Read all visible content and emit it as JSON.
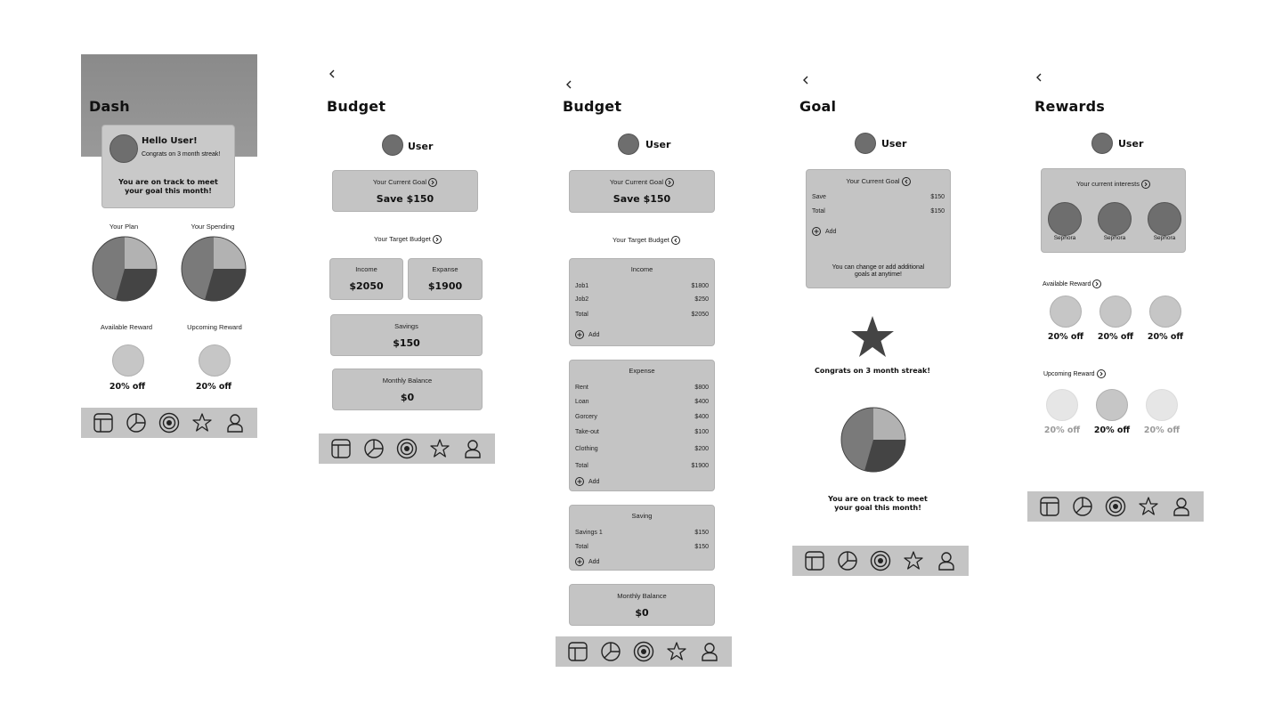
{
  "dash": {
    "title": "Dash",
    "greeting": "Hello User!",
    "streak": "Congrats on 3 month streak!",
    "message": "You are on track to meet your goal this month!",
    "plan_label": "Your Plan",
    "spending_label": "Your Spending",
    "available_label": "Available Reward",
    "upcoming_label": "Upcoming Reward",
    "available_value": "20% off",
    "upcoming_value": "20% off"
  },
  "budget1": {
    "title": "Budget",
    "user": "User",
    "goal_label": "Your Current Goal",
    "goal_value": "Save $150",
    "target_label": "Your Target Budget",
    "income_label": "Income",
    "income_value": "$2050",
    "expense_label": "Expanse",
    "expense_value": "$1900",
    "savings_label": "Savings",
    "savings_value": "$150",
    "balance_label": "Monthly Balance",
    "balance_value": "$0"
  },
  "budget2": {
    "title": "Budget",
    "user": "User",
    "goal_label": "Your Current Goal",
    "goal_value": "Save $150",
    "target_label": "Your Target Budget",
    "income": {
      "label": "Income",
      "rows": [
        [
          "Job1",
          "$1800"
        ],
        [
          "Job2",
          "$250"
        ],
        [
          "Total",
          "$2050"
        ]
      ],
      "add": "Add"
    },
    "expense": {
      "label": "Expense",
      "rows": [
        [
          "Rent",
          "$800"
        ],
        [
          "Loan",
          "$400"
        ],
        [
          "Gorcery",
          "$400"
        ],
        [
          "Take-out",
          "$100"
        ],
        [
          "Clothing",
          "$200"
        ],
        [
          "Total",
          "$1900"
        ]
      ],
      "add": "Add"
    },
    "saving": {
      "label": "Saving",
      "rows": [
        [
          "Savings 1",
          "$150"
        ],
        [
          "Total",
          "$150"
        ]
      ],
      "add": "Add"
    },
    "balance_label": "Monthly Balance",
    "balance_value": "$0"
  },
  "goal": {
    "title": "Goal",
    "user": "User",
    "current_label": "Your Current Goal",
    "rows": [
      [
        "Save",
        "$150"
      ],
      [
        "Total",
        "$150"
      ]
    ],
    "add": "Add",
    "note": "You can change or add additional goals at anytime!",
    "streak": "Congrats on 3 month streak!",
    "message": "You are on track to meet your goal this month!"
  },
  "rewards": {
    "title": "Rewards",
    "user": "User",
    "interests_label": "Your current interests",
    "interests": [
      "Sephora",
      "Sephora",
      "Sephora"
    ],
    "available_label": "Available Reward",
    "available": [
      "20% off",
      "20% off",
      "20% off"
    ],
    "upcoming_label": "Upcoming Reward",
    "upcoming": [
      "20% off",
      "20% off",
      "20% off"
    ]
  },
  "nav_icons": [
    "dashboard-icon",
    "budget-pie-icon",
    "goal-target-icon",
    "rewards-star-icon",
    "profile-icon"
  ],
  "colors": {
    "card": "#c4c4c4",
    "avatar": "#6e6e6e",
    "header": "#8c8c8c"
  }
}
